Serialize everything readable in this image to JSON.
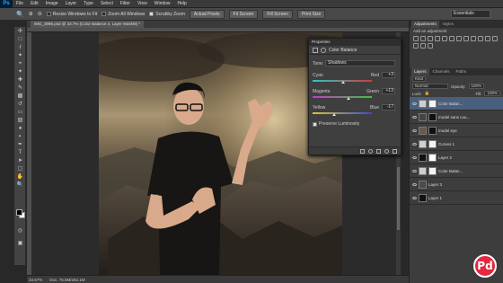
{
  "menubar": {
    "app_logo": "Ps",
    "items": [
      "File",
      "Edit",
      "Image",
      "Layer",
      "Type",
      "Select",
      "Filter",
      "View",
      "Window",
      "Help"
    ]
  },
  "options": {
    "resize_windows": "Resize Windows to Fit",
    "zoom_all": "Zoom All Windows",
    "scrubby_zoom": "Scrubby Zoom",
    "actual_pixels": "Actual Pixels",
    "fit_screen": "Fit Screen",
    "fill_screen": "Fill Screen",
    "print_size": "Print Size",
    "workspace": "Essentials"
  },
  "document": {
    "tab_label": "IMG_3995.psd @ 33.7% (Color Balance 2, Layer Mask/8) *",
    "zoom": "33.67%",
    "doc_info": "Doc: 75.5M/262.1M"
  },
  "properties": {
    "panel_title": "Properties",
    "adjustment_name": "Color Balance",
    "tone_label": "Tone:",
    "tone_value": "Shadows",
    "sliders": [
      {
        "left": "Cyan",
        "right": "Red",
        "value": "+3",
        "position": 0.52,
        "colors": [
          "#2bc6c6",
          "#d23a3a"
        ]
      },
      {
        "left": "Magenta",
        "right": "Green",
        "value": "+13",
        "position": 0.6,
        "colors": [
          "#c63ac6",
          "#3ac63a"
        ]
      },
      {
        "left": "Yellow",
        "right": "Blue",
        "value": "-17",
        "position": 0.36,
        "colors": [
          "#d6c63a",
          "#3a4ad6"
        ]
      }
    ],
    "preserve_luminosity": "Preserve Luminosity"
  },
  "adjustments_panel": {
    "tabs": [
      "Adjustments",
      "Styles"
    ],
    "hint": "Add an adjustment"
  },
  "layers_panel": {
    "tabs": [
      "Layers",
      "Channels",
      "Paths"
    ],
    "kind": "Kind",
    "blend_mode": "Normal",
    "opacity_label": "Opacity:",
    "opacity_value": "100%",
    "lock_label": "Lock:",
    "fill_label": "Fill:",
    "fill_value": "100%",
    "layers": [
      {
        "name": "Color Balan...",
        "thumb": "#cfcfcf",
        "mask": "#f4f4f4",
        "selected": true
      },
      {
        "name": "model sans cou...",
        "thumb": "#444",
        "mask": "#111",
        "selected": false
      },
      {
        "name": "model eye",
        "thumb": "#6a5a4a",
        "mask": "#111",
        "selected": false
      },
      {
        "name": "Curves 1",
        "thumb": "#cfcfcf",
        "mask": "#f4f4f4",
        "selected": false
      },
      {
        "name": "Layer 2",
        "thumb": "#111",
        "mask": "#fff",
        "selected": false
      },
      {
        "name": "Color Balan...",
        "thumb": "#cfcfcf",
        "mask": "#f4f4f4",
        "selected": false
      },
      {
        "name": "Layer 3",
        "thumb": "#4b4b4b",
        "mask": "",
        "selected": false
      },
      {
        "name": "Layer 1",
        "thumb": "#111",
        "mask": "",
        "selected": false
      }
    ]
  },
  "watermark": {
    "text": "Pd"
  }
}
